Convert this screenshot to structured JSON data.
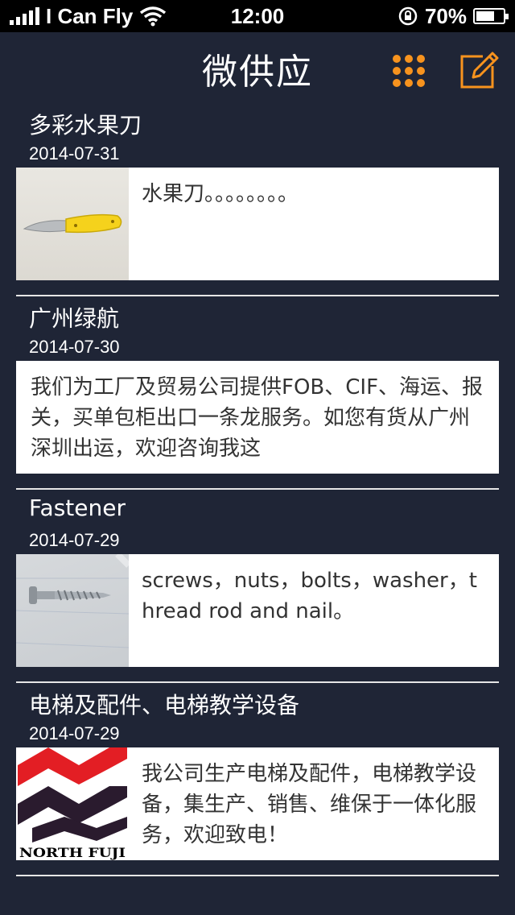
{
  "status_bar": {
    "carrier": "I Can Fly",
    "time": "12:00",
    "battery": "70%",
    "battery_level": 0.7
  },
  "nav": {
    "title": "微供应",
    "accent_color": "#f7931e"
  },
  "posts": [
    {
      "title": "多彩水果刀",
      "date": "2014-07-31",
      "text": "水果刀。。。。。。。。",
      "thumbnail": "fruit-knife-photo"
    },
    {
      "title": "广州绿航",
      "date": "2014-07-30",
      "text": "我们为工厂及贸易公司提供FOB、CIF、海运、报关，买单包柜出口一条龙服务。如您有货从广州深圳出运，欢迎咨询我这"
    },
    {
      "title": "Fastener",
      "date": "2014-07-29",
      "text": "screws，nuts，bolts，washer，thread rod and nail。",
      "thumbnail": "screw-photo"
    },
    {
      "title": "电梯及配件、电梯教学设备",
      "date": "2014-07-29",
      "text": "我公司生产电梯及配件，电梯教学设备，集生产、销售、维保于一体化服务，欢迎致电！",
      "logo_text": "NORTH FUJI"
    }
  ]
}
